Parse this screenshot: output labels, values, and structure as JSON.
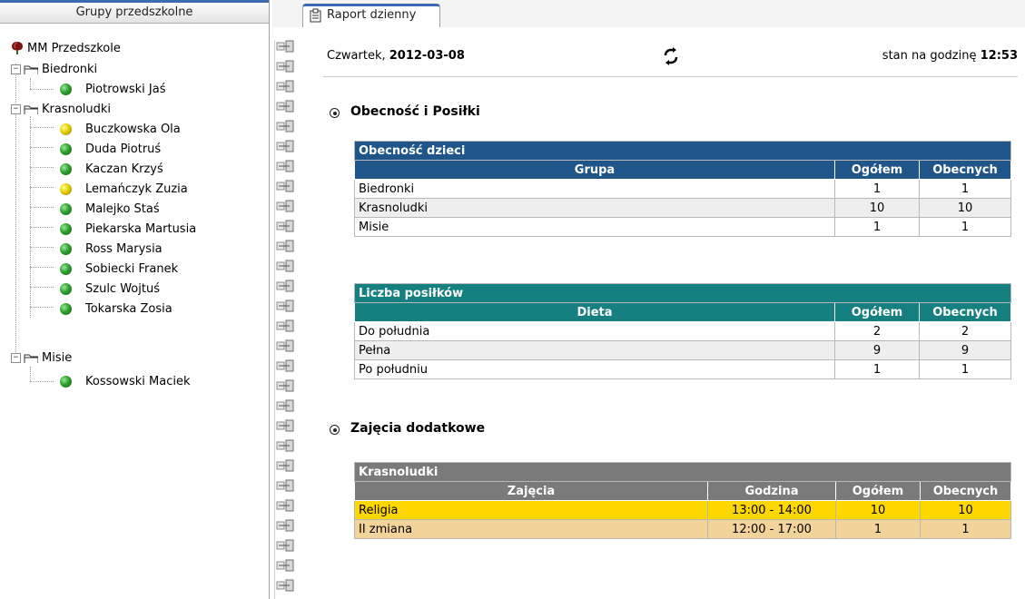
{
  "left_panel": {
    "header": "Grupy przedszkolne",
    "root": "MM Przedszkole",
    "groups": [
      {
        "name": "Biedronki",
        "children": [
          {
            "name": "Piotrowski Jaś",
            "status": "green"
          }
        ]
      },
      {
        "name": "Krasnoludki",
        "children": [
          {
            "name": "Buczkowska Ola",
            "status": "yellow"
          },
          {
            "name": "Duda Piotruś",
            "status": "green"
          },
          {
            "name": "Kaczan Krzyś",
            "status": "green"
          },
          {
            "name": "Lemańczyk Zuzia",
            "status": "yellow"
          },
          {
            "name": "Malejko Staś",
            "status": "green"
          },
          {
            "name": "Piekarska Martusia",
            "status": "green"
          },
          {
            "name": "Ross Marysia",
            "status": "green"
          },
          {
            "name": "Sobiecki Franek",
            "status": "green"
          },
          {
            "name": "Szulc Wojtuś",
            "status": "green"
          },
          {
            "name": "Tokarska Zosia",
            "status": "green"
          }
        ]
      },
      {
        "name": "Misie",
        "children": [
          {
            "name": "Kossowski Maciek",
            "status": "green"
          }
        ]
      }
    ]
  },
  "tab": {
    "label": "Raport dzienny",
    "icon": "report-icon"
  },
  "report": {
    "day_prefix": "Czwartek, ",
    "date": "2012-03-08",
    "refresh_icon": "refresh-icon",
    "time_prefix": "stan na godzinę ",
    "time": "12:53",
    "section1": "Obecność i Posiłki",
    "section2": "Zajęcia dodatkowe",
    "attendance": {
      "caption": "Obecność dzieci",
      "headers": [
        "Grupa",
        "Ogółem",
        "Obecnych"
      ],
      "rows": [
        [
          "Biedronki",
          "1",
          "1"
        ],
        [
          "Krasnoludki",
          "10",
          "10"
        ],
        [
          "Misie",
          "1",
          "1"
        ]
      ]
    },
    "meals": {
      "caption": "Liczba posiłków",
      "headers": [
        "Dieta",
        "Ogółem",
        "Obecnych"
      ],
      "rows": [
        [
          "Do południa",
          "2",
          "2"
        ],
        [
          "Pełna",
          "9",
          "9"
        ],
        [
          "Po południu",
          "1",
          "1"
        ]
      ]
    },
    "activities": {
      "caption": "Krasnoludki",
      "headers": [
        "Zajęcia",
        "Godzina",
        "Ogółem",
        "Obecnych"
      ],
      "rows": [
        [
          "Religia",
          "13:00 - 14:00",
          "10",
          "10"
        ],
        [
          "II zmiana",
          "12:00 - 17:00",
          "1",
          "1"
        ]
      ]
    }
  },
  "colors": {
    "attendance_header": "#1f5588",
    "meals_header": "#168080",
    "activities_header": "#7a7a7a",
    "row_alt": "#eeeeee",
    "religia_row": "#ffd700",
    "zmiana_row": "#f2d49a"
  }
}
